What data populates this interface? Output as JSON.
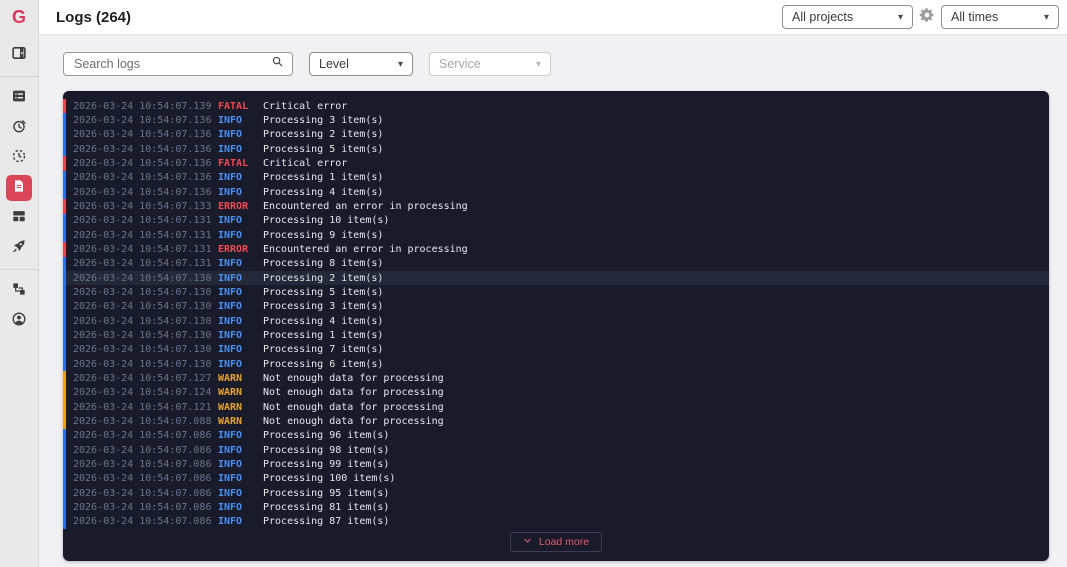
{
  "app": {
    "logo_letter": "G"
  },
  "sidebar": {
    "items": [
      {
        "name": "issues",
        "icon": "panel-play-icon"
      },
      {
        "name": "monitors",
        "icon": "list-icon"
      },
      {
        "name": "uptime",
        "icon": "clock-history-icon"
      },
      {
        "name": "cron-jobs",
        "icon": "timer-icon"
      },
      {
        "name": "logs",
        "icon": "document-icon",
        "active": true
      },
      {
        "name": "dashboards",
        "icon": "dashboard-icon"
      },
      {
        "name": "releases",
        "icon": "rocket-icon"
      },
      {
        "name": "organization",
        "icon": "sitemap-icon"
      },
      {
        "name": "profile",
        "icon": "account-icon"
      }
    ]
  },
  "header": {
    "title": "Logs (264)",
    "project_filter": "All projects",
    "time_filter": "All times"
  },
  "filters": {
    "search_placeholder": "Search logs",
    "search_value": "",
    "level_label": "Level",
    "service_label": "Service"
  },
  "icons": {
    "caret": "▾"
  },
  "logs": {
    "total_count": 264,
    "load_more_label": "Load more",
    "rows": [
      {
        "ts": "2026-03-24 10:54:07.139",
        "level": "FATAL",
        "msg": "Critical error"
      },
      {
        "ts": "2026-03-24 10:54:07.136",
        "level": "INFO",
        "msg": "Processing 3 item(s)"
      },
      {
        "ts": "2026-03-24 10:54:07.136",
        "level": "INFO",
        "msg": "Processing 2 item(s)"
      },
      {
        "ts": "2026-03-24 10:54:07.136",
        "level": "INFO",
        "msg": "Processing 5 item(s)"
      },
      {
        "ts": "2026-03-24 10:54:07.136",
        "level": "FATAL",
        "msg": "Critical error"
      },
      {
        "ts": "2026-03-24 10:54:07.136",
        "level": "INFO",
        "msg": "Processing 1 item(s)"
      },
      {
        "ts": "2026-03-24 10:54:07.136",
        "level": "INFO",
        "msg": "Processing 4 item(s)"
      },
      {
        "ts": "2026-03-24 10:54:07.133",
        "level": "ERROR",
        "msg": "Encountered an error in processing"
      },
      {
        "ts": "2026-03-24 10:54:07.131",
        "level": "INFO",
        "msg": "Processing 10 item(s)"
      },
      {
        "ts": "2026-03-24 10:54:07.131",
        "level": "INFO",
        "msg": "Processing 9 item(s)"
      },
      {
        "ts": "2026-03-24 10:54:07.131",
        "level": "ERROR",
        "msg": "Encountered an error in processing"
      },
      {
        "ts": "2026-03-24 10:54:07.131",
        "level": "INFO",
        "msg": "Processing 8 item(s)"
      },
      {
        "ts": "2026-03-24 10:54:07.130",
        "level": "INFO",
        "msg": "Processing 2 item(s)",
        "highlighted": true
      },
      {
        "ts": "2026-03-24 10:54:07.130",
        "level": "INFO",
        "msg": "Processing 5 item(s)"
      },
      {
        "ts": "2026-03-24 10:54:07.130",
        "level": "INFO",
        "msg": "Processing 3 item(s)"
      },
      {
        "ts": "2026-03-24 10:54:07.130",
        "level": "INFO",
        "msg": "Processing 4 item(s)"
      },
      {
        "ts": "2026-03-24 10:54:07.130",
        "level": "INFO",
        "msg": "Processing 1 item(s)"
      },
      {
        "ts": "2026-03-24 10:54:07.130",
        "level": "INFO",
        "msg": "Processing 7 item(s)"
      },
      {
        "ts": "2026-03-24 10:54:07.130",
        "level": "INFO",
        "msg": "Processing 6 item(s)"
      },
      {
        "ts": "2026-03-24 10:54:07.127",
        "level": "WARN",
        "msg": "Not enough data for processing"
      },
      {
        "ts": "2026-03-24 10:54:07.124",
        "level": "WARN",
        "msg": "Not enough data for processing"
      },
      {
        "ts": "2026-03-24 10:54:07.121",
        "level": "WARN",
        "msg": "Not enough data for processing"
      },
      {
        "ts": "2026-03-24 10:54:07.088",
        "level": "WARN",
        "msg": "Not enough data for processing"
      },
      {
        "ts": "2026-03-24 10:54:07.086",
        "level": "INFO",
        "msg": "Processing 96 item(s)"
      },
      {
        "ts": "2026-03-24 10:54:07.086",
        "level": "INFO",
        "msg": "Processing 98 item(s)"
      },
      {
        "ts": "2026-03-24 10:54:07.086",
        "level": "INFO",
        "msg": "Processing 99 item(s)"
      },
      {
        "ts": "2026-03-24 10:54:07.086",
        "level": "INFO",
        "msg": "Processing 100 item(s)"
      },
      {
        "ts": "2026-03-24 10:54:07.086",
        "level": "INFO",
        "msg": "Processing 95 item(s)"
      },
      {
        "ts": "2026-03-24 10:54:07.086",
        "level": "INFO",
        "msg": "Processing 81 item(s)"
      },
      {
        "ts": "2026-03-24 10:54:07.086",
        "level": "INFO",
        "msg": "Processing 87 item(s)"
      }
    ]
  },
  "colors": {
    "accent": "#da4558",
    "panel_bg": "#191b2b",
    "info": "#4a90f4",
    "info_bar": "#2c6fe8",
    "warn": "#e9a42e",
    "error": "#ef4a50",
    "fatal": "#ef4a50",
    "timestamp": "#70748a",
    "message": "#e7e7ed",
    "load_more": "#e25d70"
  }
}
